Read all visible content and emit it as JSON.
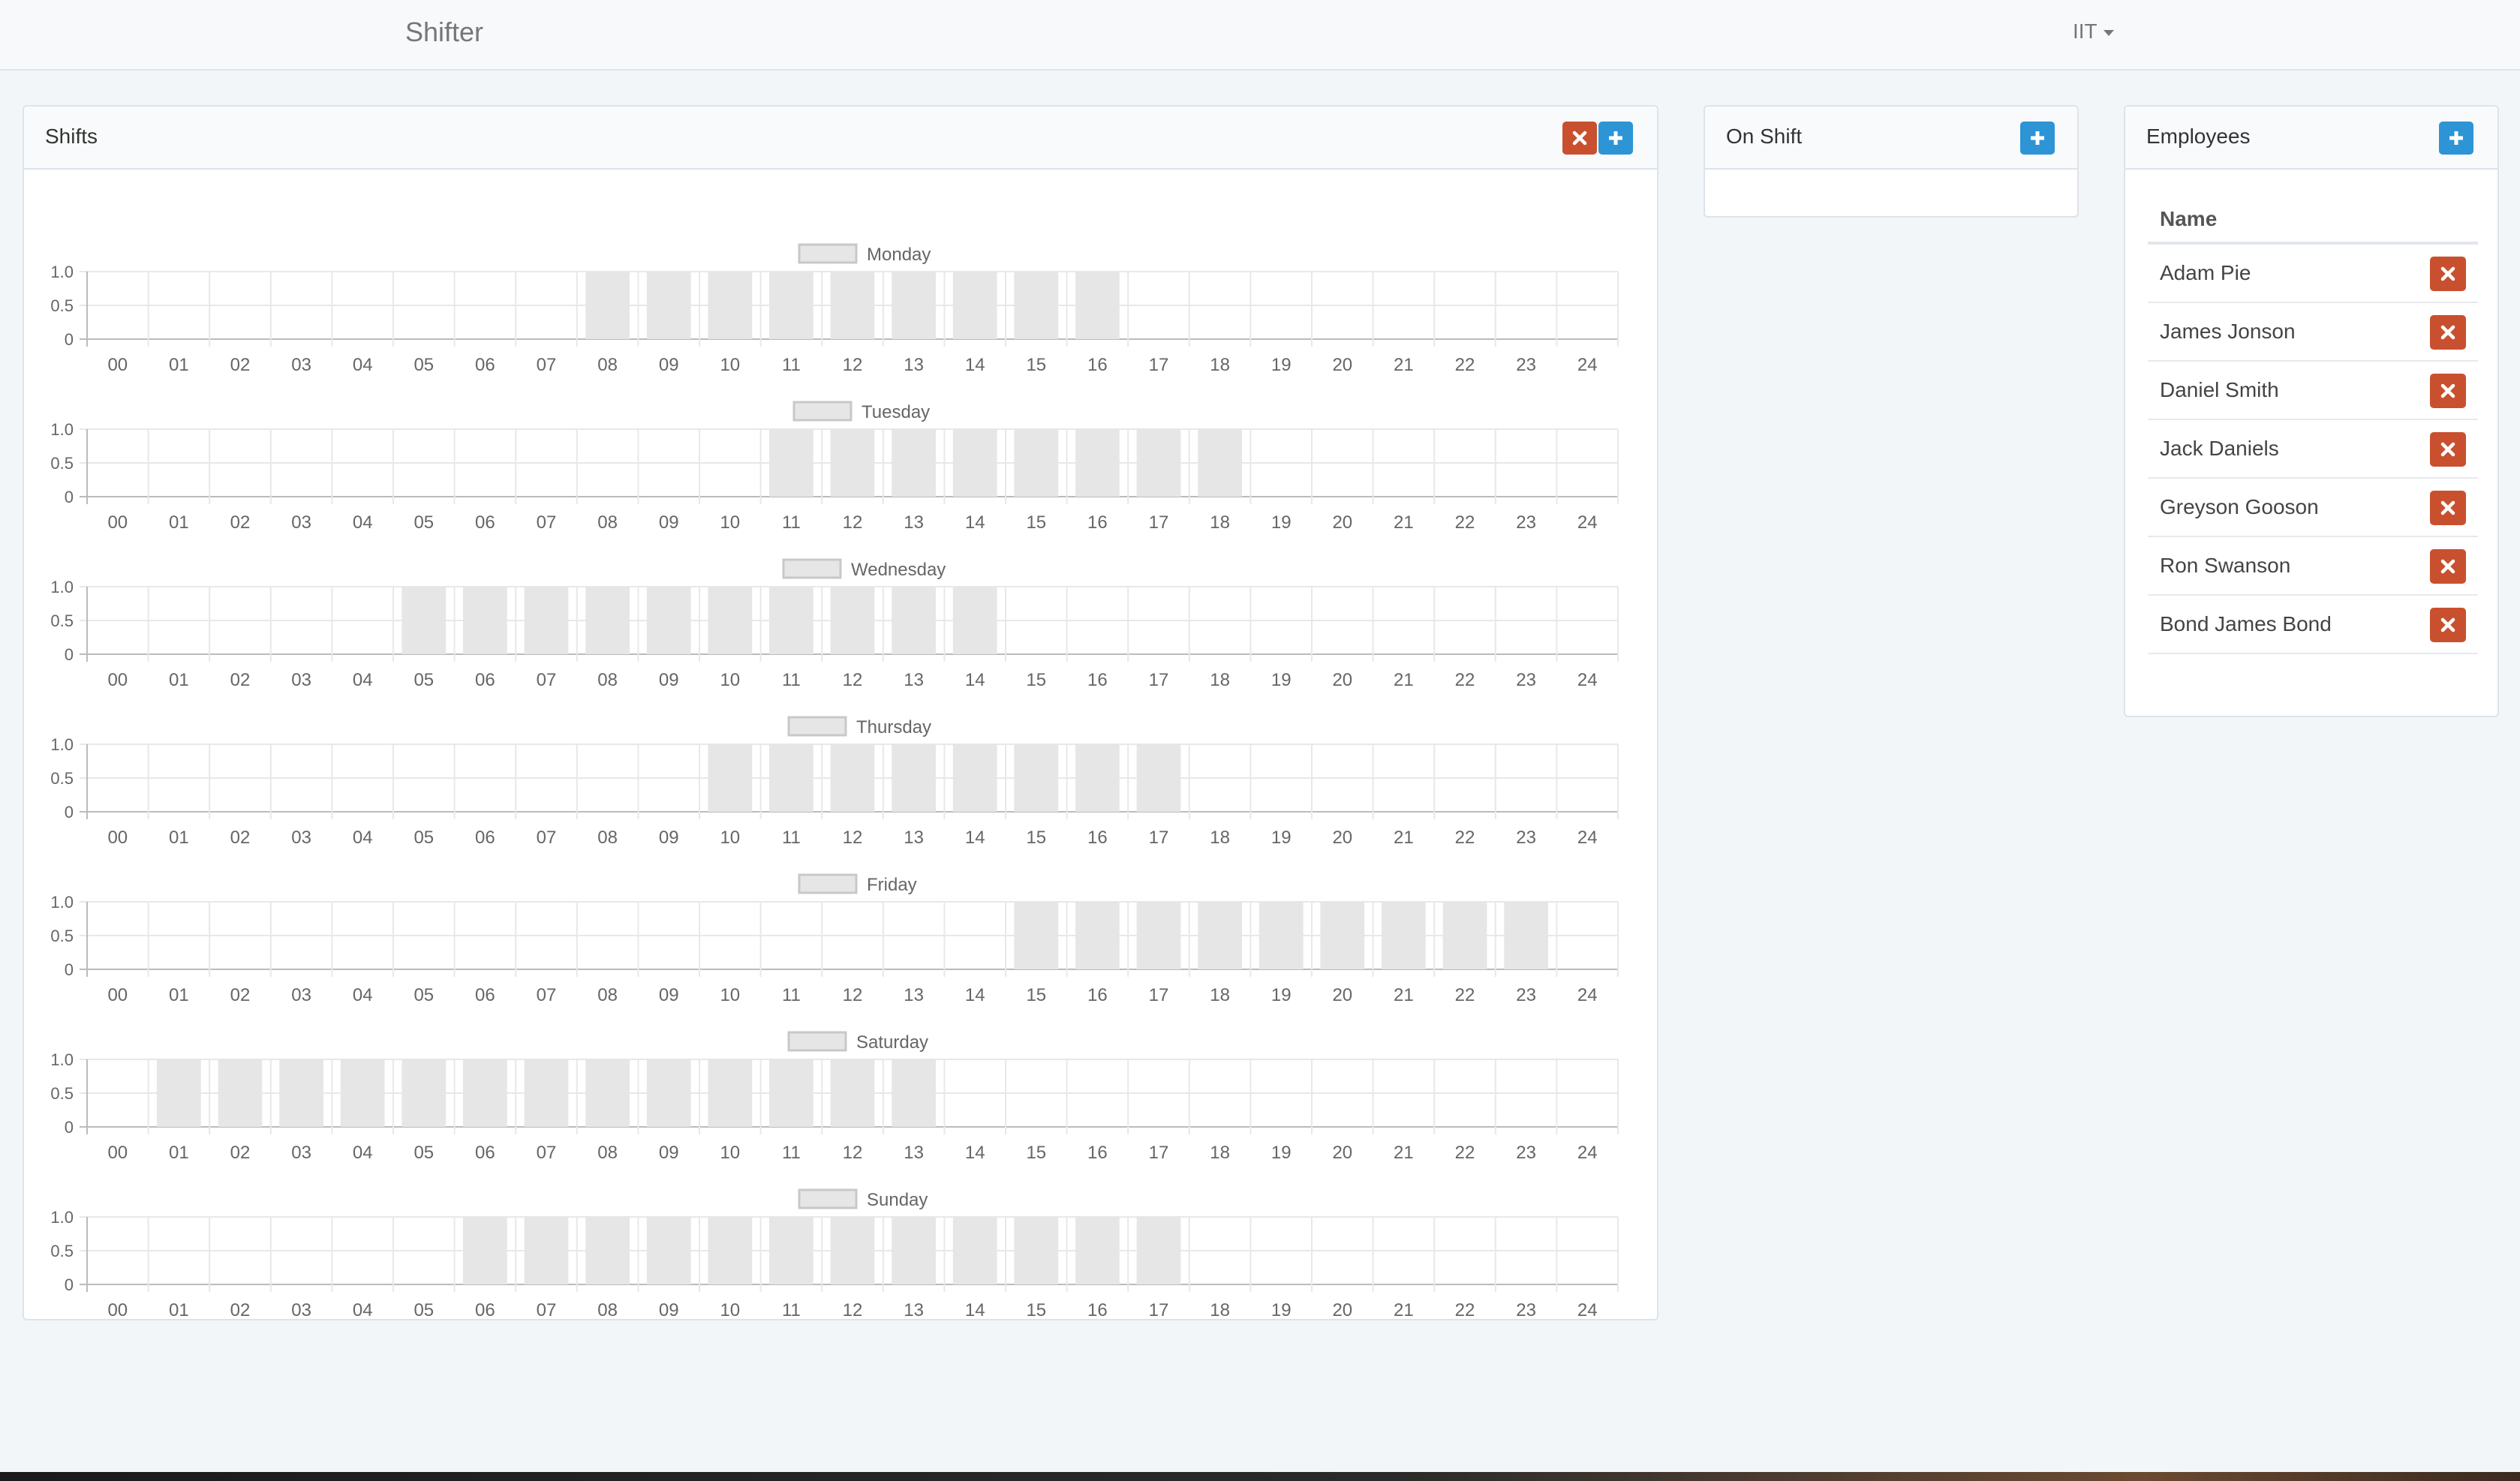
{
  "navbar": {
    "brand": "Shifter",
    "user": "IIT"
  },
  "shifts_panel": {
    "title": "Shifts"
  },
  "on_shift_panel": {
    "title": "On Shift"
  },
  "employees_panel": {
    "title": "Employees",
    "column_header": "Name",
    "employees": [
      "Adam Pie",
      "James Jonson",
      "Daniel Smith",
      "Jack Daniels",
      "Greyson Gooson",
      "Ron Swanson",
      "Bond James Bond"
    ]
  },
  "colors": {
    "bar_fill": "#e6e6e6",
    "add_button": "#2d94d6",
    "delete_button": "#c9502f"
  },
  "icons": {
    "add": "plus-icon",
    "remove": "times-icon",
    "user_menu": "caret-down-icon"
  },
  "chart_data": [
    {
      "type": "bar",
      "series_name": "Monday",
      "x": [
        "00",
        "01",
        "02",
        "03",
        "04",
        "05",
        "06",
        "07",
        "08",
        "09",
        "10",
        "11",
        "12",
        "13",
        "14",
        "15",
        "16",
        "17",
        "18",
        "19",
        "20",
        "21",
        "22",
        "23",
        "24"
      ],
      "values": [
        0,
        0,
        0,
        0,
        0,
        0,
        0,
        0,
        1,
        1,
        1,
        1,
        1,
        1,
        1,
        1,
        1,
        0,
        0,
        0,
        0,
        0,
        0,
        0,
        0
      ],
      "ylim": [
        0,
        1.0
      ],
      "yticks": [
        "1.0",
        "0.5",
        "0"
      ]
    },
    {
      "type": "bar",
      "series_name": "Tuesday",
      "x": [
        "00",
        "01",
        "02",
        "03",
        "04",
        "05",
        "06",
        "07",
        "08",
        "09",
        "10",
        "11",
        "12",
        "13",
        "14",
        "15",
        "16",
        "17",
        "18",
        "19",
        "20",
        "21",
        "22",
        "23",
        "24"
      ],
      "values": [
        0,
        0,
        0,
        0,
        0,
        0,
        0,
        0,
        0,
        0,
        0,
        1,
        1,
        1,
        1,
        1,
        1,
        1,
        1,
        0,
        0,
        0,
        0,
        0,
        0
      ],
      "ylim": [
        0,
        1.0
      ],
      "yticks": [
        "1.0",
        "0.5",
        "0"
      ]
    },
    {
      "type": "bar",
      "series_name": "Wednesday",
      "x": [
        "00",
        "01",
        "02",
        "03",
        "04",
        "05",
        "06",
        "07",
        "08",
        "09",
        "10",
        "11",
        "12",
        "13",
        "14",
        "15",
        "16",
        "17",
        "18",
        "19",
        "20",
        "21",
        "22",
        "23",
        "24"
      ],
      "values": [
        0,
        0,
        0,
        0,
        0,
        1,
        1,
        1,
        1,
        1,
        1,
        1,
        1,
        1,
        1,
        0,
        0,
        0,
        0,
        0,
        0,
        0,
        0,
        0,
        0
      ],
      "ylim": [
        0,
        1.0
      ],
      "yticks": [
        "1.0",
        "0.5",
        "0"
      ]
    },
    {
      "type": "bar",
      "series_name": "Thursday",
      "x": [
        "00",
        "01",
        "02",
        "03",
        "04",
        "05",
        "06",
        "07",
        "08",
        "09",
        "10",
        "11",
        "12",
        "13",
        "14",
        "15",
        "16",
        "17",
        "18",
        "19",
        "20",
        "21",
        "22",
        "23",
        "24"
      ],
      "values": [
        0,
        0,
        0,
        0,
        0,
        0,
        0,
        0,
        0,
        0,
        1,
        1,
        1,
        1,
        1,
        1,
        1,
        1,
        0,
        0,
        0,
        0,
        0,
        0,
        0
      ],
      "ylim": [
        0,
        1.0
      ],
      "yticks": [
        "1.0",
        "0.5",
        "0"
      ]
    },
    {
      "type": "bar",
      "series_name": "Friday",
      "x": [
        "00",
        "01",
        "02",
        "03",
        "04",
        "05",
        "06",
        "07",
        "08",
        "09",
        "10",
        "11",
        "12",
        "13",
        "14",
        "15",
        "16",
        "17",
        "18",
        "19",
        "20",
        "21",
        "22",
        "23",
        "24"
      ],
      "values": [
        0,
        0,
        0,
        0,
        0,
        0,
        0,
        0,
        0,
        0,
        0,
        0,
        0,
        0,
        0,
        1,
        1,
        1,
        1,
        1,
        1,
        1,
        1,
        1,
        0
      ],
      "ylim": [
        0,
        1.0
      ],
      "yticks": [
        "1.0",
        "0.5",
        "0"
      ]
    },
    {
      "type": "bar",
      "series_name": "Saturday",
      "x": [
        "00",
        "01",
        "02",
        "03",
        "04",
        "05",
        "06",
        "07",
        "08",
        "09",
        "10",
        "11",
        "12",
        "13",
        "14",
        "15",
        "16",
        "17",
        "18",
        "19",
        "20",
        "21",
        "22",
        "23",
        "24"
      ],
      "values": [
        0,
        1,
        1,
        1,
        1,
        1,
        1,
        1,
        1,
        1,
        1,
        1,
        1,
        1,
        0,
        0,
        0,
        0,
        0,
        0,
        0,
        0,
        0,
        0,
        0
      ],
      "ylim": [
        0,
        1.0
      ],
      "yticks": [
        "1.0",
        "0.5",
        "0"
      ]
    },
    {
      "type": "bar",
      "series_name": "Sunday",
      "x": [
        "00",
        "01",
        "02",
        "03",
        "04",
        "05",
        "06",
        "07",
        "08",
        "09",
        "10",
        "11",
        "12",
        "13",
        "14",
        "15",
        "16",
        "17",
        "18",
        "19",
        "20",
        "21",
        "22",
        "23",
        "24"
      ],
      "values": [
        0,
        0,
        0,
        0,
        0,
        0,
        1,
        1,
        1,
        1,
        1,
        1,
        1,
        1,
        1,
        1,
        1,
        1,
        0,
        0,
        0,
        0,
        0,
        0,
        0
      ],
      "ylim": [
        0,
        1.0
      ],
      "yticks": [
        "1.0",
        "0.5",
        "0"
      ]
    }
  ]
}
